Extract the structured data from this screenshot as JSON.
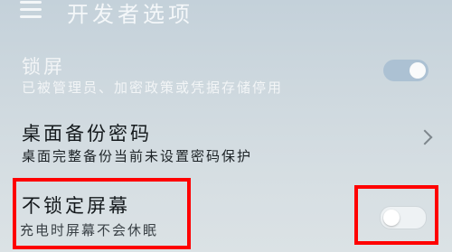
{
  "header": {
    "title": "开发者选项",
    "menu_icon": "menu-icon"
  },
  "rows": {
    "lock": {
      "title": "锁屏",
      "subtitle": "已被管理员、加密政策或凭据存储停用",
      "toggle_on": true,
      "disabled": true
    },
    "backup": {
      "title": "桌面备份密码",
      "subtitle": "桌面完整备份当前未设置密码保护",
      "trailing_icon": "chevron-right-icon"
    },
    "stay_awake": {
      "title": "不锁定屏幕",
      "subtitle": "充电时屏幕不会休眠",
      "toggle_on": false
    }
  },
  "colors": {
    "highlight": "#ff0000",
    "toggle_on_track": "#a9bfd2",
    "toggle_off_track": "#eef2f4"
  }
}
